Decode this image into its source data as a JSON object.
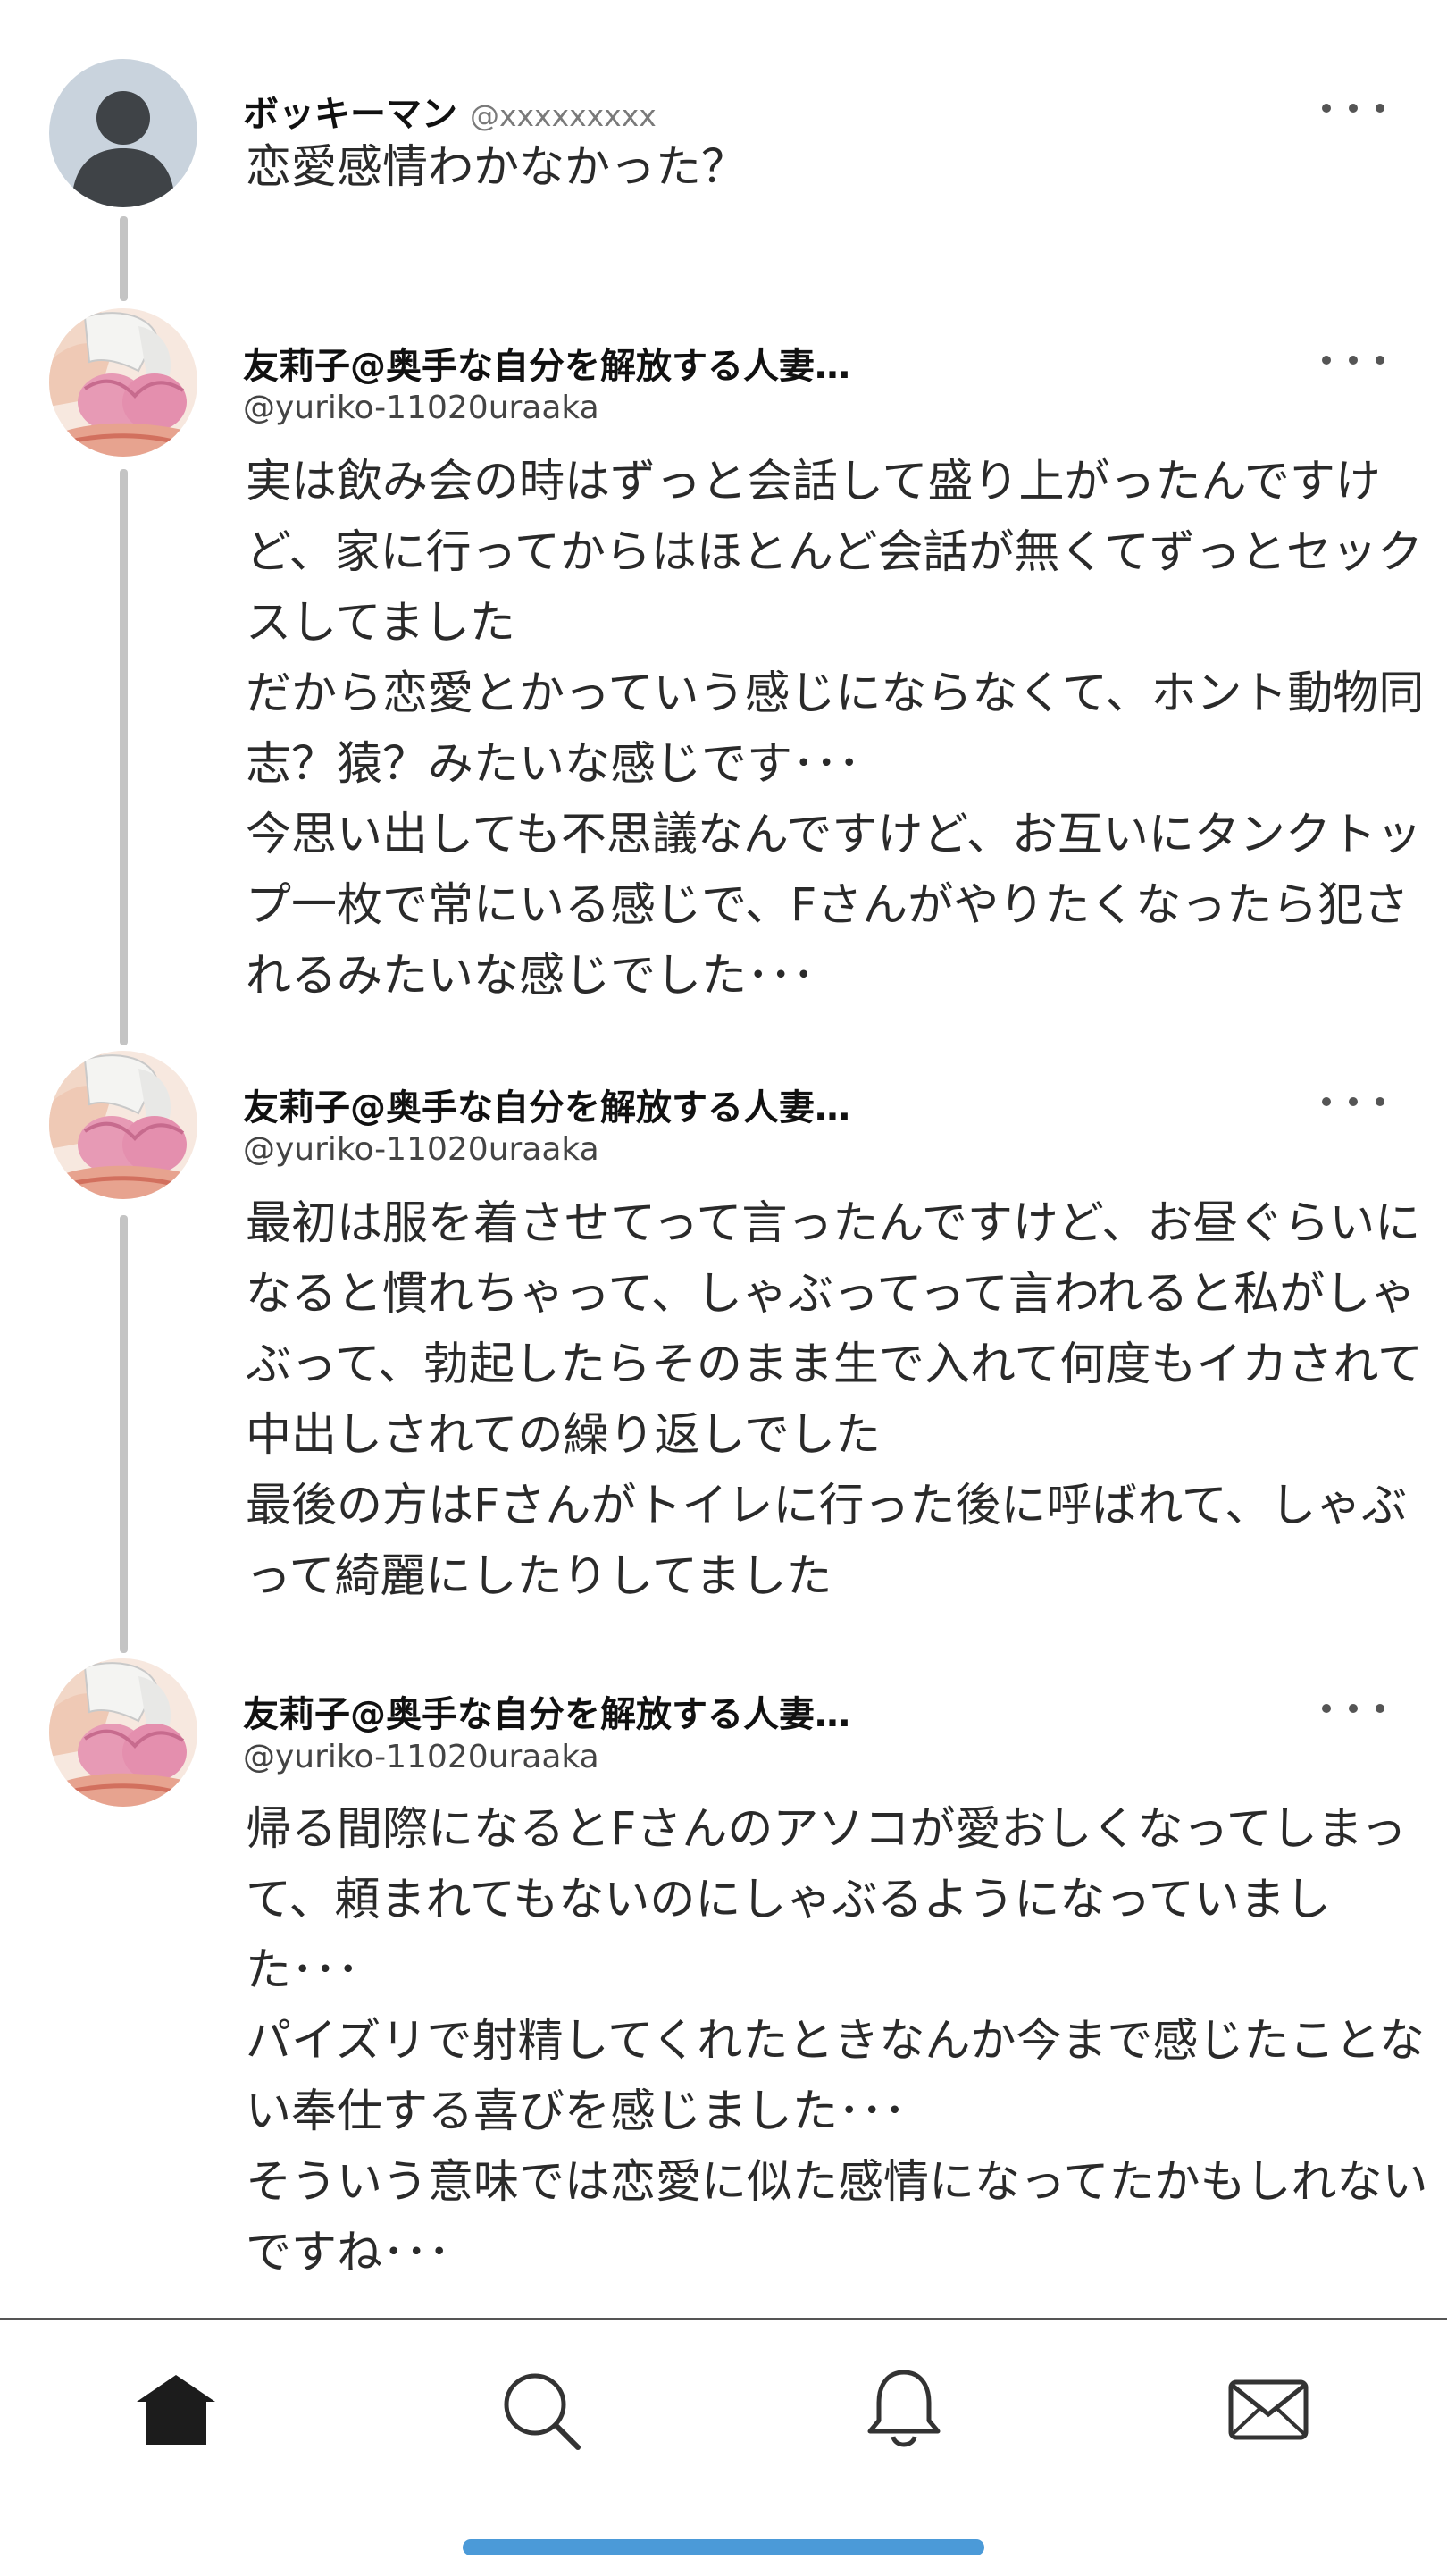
{
  "thread": {
    "root": {
      "display_name": "ボッキーマン",
      "handle": "@xxxxxxxxx",
      "avatar_icon": "default-user-silhouette-icon",
      "text": "恋愛感情わかなかった？"
    },
    "replies": [
      {
        "display_name": "友莉子@奥手な自分を解放する人妻…",
        "handle": "@yuriko-11020uraaka",
        "avatar_icon": "profile-photo-avatar",
        "text": "実は飲み会の時はずっと会話して盛り上がったんですけど、家に行ってからはほとんど会話が無くてずっとセックスしてました\nだから恋愛とかっていう感じにならなくて、ホント動物同志？猿？みたいな感じです･･･\n今思い出しても不思議なんですけど、お互いにタンクトップ一枚で常にいる感じで、Fさんがやりたくなったら犯されるみたいな感じでした･･･"
      },
      {
        "display_name": "友莉子@奥手な自分を解放する人妻…",
        "handle": "@yuriko-11020uraaka",
        "avatar_icon": "profile-photo-avatar",
        "text": "最初は服を着させてって言ったんですけど、お昼ぐらいになると慣れちゃって、しゃぶってって言われると私がしゃぶって、勃起したらそのまま生で入れて何度もイカされて中出しされての繰り返しでした\n最後の方はFさんがトイレに行った後に呼ばれて、しゃぶって綺麗にしたりしてました"
      },
      {
        "display_name": "友莉子@奥手な自分を解放する人妻…",
        "handle": "@yuriko-11020uraaka",
        "avatar_icon": "profile-photo-avatar",
        "text": "帰る間際になるとFさんのアソコが愛おしくなってしまって、頼まれてもないのにしゃぶるようになっていました･･･\nパイズリで射精してくれたときなんか今まで感じたことない奉仕する喜びを感じました･･･\nそういう意味では恋愛に似た感情になってたかもしれないですね･･･"
      }
    ]
  },
  "tabbar": {
    "items": [
      {
        "name": "home",
        "icon": "home-icon",
        "active": true
      },
      {
        "name": "search",
        "icon": "search-icon",
        "active": false
      },
      {
        "name": "notifications",
        "icon": "bell-icon",
        "active": false
      },
      {
        "name": "messages",
        "icon": "mail-icon",
        "active": false
      }
    ]
  },
  "colors": {
    "thread_line": "#c4c4c4",
    "home_indicator": "#4b9ad8",
    "text": "#2a2a2a"
  }
}
